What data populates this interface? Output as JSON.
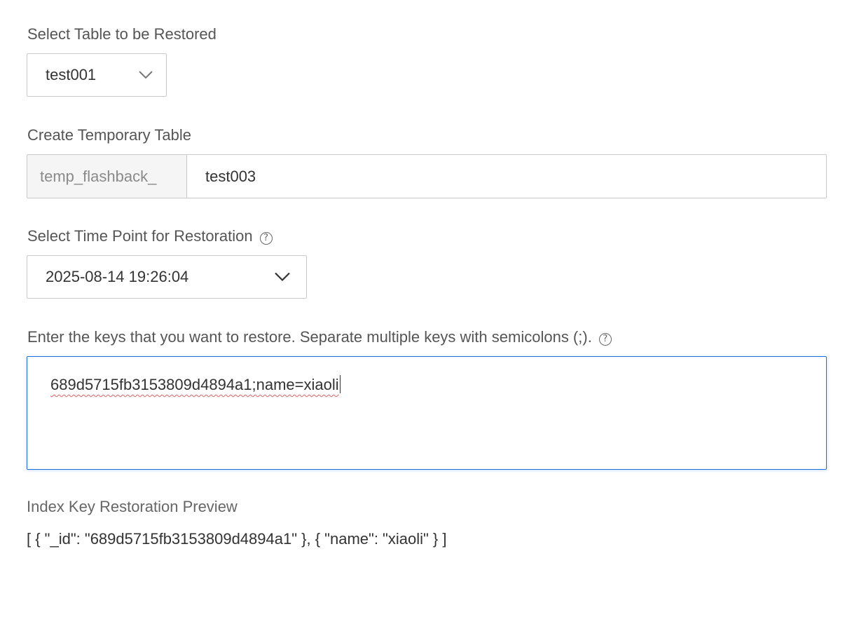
{
  "table_select": {
    "label": "Select Table to be Restored",
    "value": "test001"
  },
  "temp_table": {
    "label": "Create Temporary Table",
    "prefix": "temp_flashback_",
    "value": "test003"
  },
  "time_point": {
    "label": "Select Time Point for Restoration",
    "value": "2025-08-14 19:26:04"
  },
  "keys_input": {
    "label": "Enter the keys that you want to restore. Separate multiple keys with semicolons (;).",
    "value": "689d5715fb3153809d4894a1;name=xiaoli"
  },
  "preview": {
    "label": "Index Key Restoration Preview",
    "value": "[ { \"_id\": \"689d5715fb3153809d4894a1\" }, { \"name\": \"xiaoli\" } ]"
  },
  "icons": {
    "help": "question-circle-icon",
    "dropdown": "chevron-down-icon"
  },
  "colors": {
    "focus_border": "#1e6fd9",
    "border": "#c9c9c9",
    "addon_bg": "#f5f5f5",
    "spellcheck": "#e06060"
  }
}
